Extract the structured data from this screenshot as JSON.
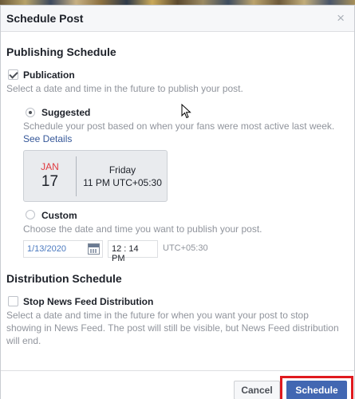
{
  "dialog": {
    "title": "Schedule Post",
    "close_glyph": "×"
  },
  "publishing": {
    "section_title": "Publishing Schedule",
    "publication_label": "Publication",
    "publication_checked": true,
    "publication_desc": "Select a date and time in the future to publish your post.",
    "suggested": {
      "label": "Suggested",
      "selected": true,
      "desc": "Schedule your post based on when your fans were most active last week.",
      "see_details": "See Details",
      "month": "JAN",
      "day": "17",
      "weekday": "Friday",
      "time": "11 PM UTC+05:30"
    },
    "custom": {
      "label": "Custom",
      "selected": false,
      "desc": "Choose the date and time you want to publish your post.",
      "date_value": "1/13/2020",
      "time_value": "12 : 14 PM",
      "timezone": "UTC+05:30"
    }
  },
  "distribution": {
    "section_title": "Distribution Schedule",
    "stop_label": "Stop News Feed Distribution",
    "stop_checked": false,
    "desc_line1": "Select a date and time in the future for when you want your post to stop",
    "desc_line2": "showing in News Feed. The post will still be visible, but News Feed distribution",
    "desc_line3": "will end."
  },
  "footer": {
    "cancel_label": "Cancel",
    "schedule_label": "Schedule"
  },
  "colors": {
    "primary": "#4267b2",
    "highlight_outline": "#e0191e",
    "month_red": "#e0393e",
    "link": "#365899"
  },
  "icons": [
    "close-icon",
    "checkmark-icon",
    "calendar-icon",
    "cursor-icon"
  ]
}
